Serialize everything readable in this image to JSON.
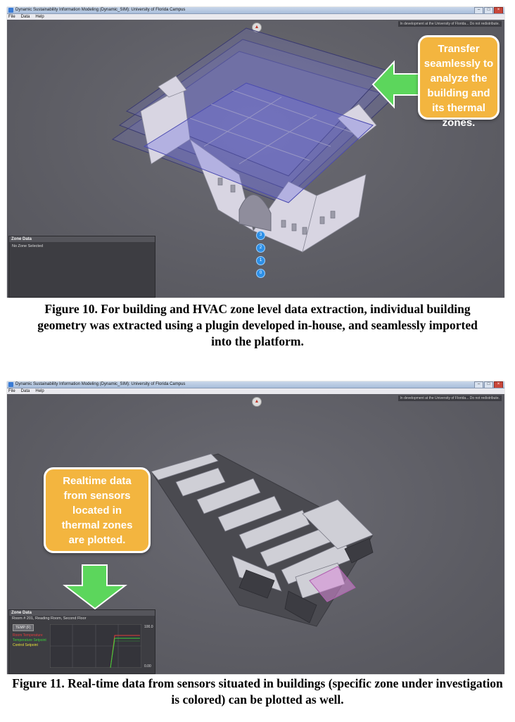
{
  "figure10": {
    "window_title": "Dynamic Sustainability Information Modeling (Dynamic_SIM): University of Florida Campus",
    "menu": [
      "File",
      "Data",
      "Help"
    ],
    "dev_note": "In development at the University of Florida... Do not redistribute.",
    "callout": "Transfer seamlessly to analyze the building and its thermal zones.",
    "zone_panel": {
      "title": "Zone Data",
      "status": "No Zone Selected"
    },
    "floor_buttons": [
      "3",
      "2",
      "1",
      "0"
    ],
    "caption": "Figure 10. For building and HVAC zone level data extraction, individual building geometry was extracted using a plugin developed in-house, and seamlessly imported into the platform."
  },
  "figure11": {
    "window_title": "Dynamic Sustainability Information Modeling (Dynamic_SIM): University of Florida Campus",
    "menu": [
      "File",
      "Data",
      "Help"
    ],
    "dev_note": "In development at the University of Florida... Do not redistribute.",
    "callout": "Realtime data from sensors located in thermal zones are plotted.",
    "zone_panel": {
      "title": "Zone Data",
      "room": "Room # 201, Reading Room, Second Floor",
      "temp_button": "TEMP (F)",
      "legend": [
        {
          "label": "Room Temperature",
          "color": "#e23b3b"
        },
        {
          "label": "Temperature Setpoint",
          "color": "#3ad13a"
        },
        {
          "label": "Control Setpoint",
          "color": "#e8e23a"
        }
      ],
      "y_max": "100.0",
      "y_min": "0.00"
    },
    "caption": "Figure 11. Real-time data from sensors situated in buildings (specific zone under investigation is colored) can be plotted as well."
  },
  "colors": {
    "callout": "#f3b53f",
    "arrow": "#5cd65c",
    "zone_highlight": "#d98ad9",
    "floor_button": "#2d8fe6"
  }
}
